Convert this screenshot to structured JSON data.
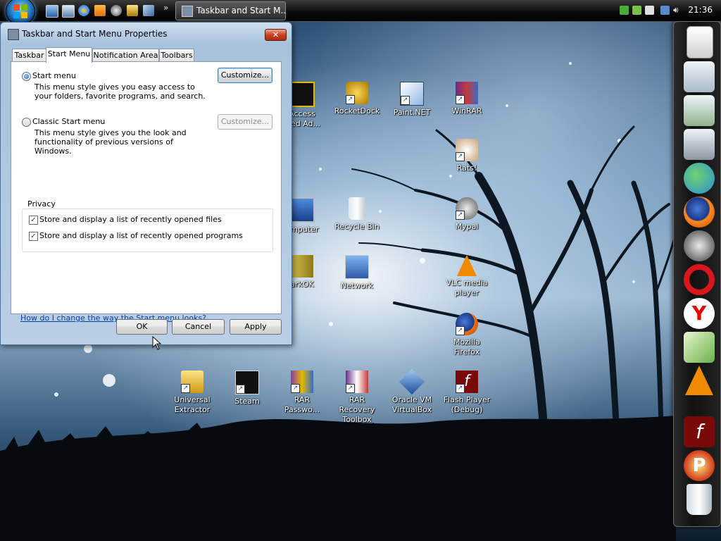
{
  "taskbar": {
    "quick_launch": [
      "show-desktop-icon",
      "switch-windows-icon",
      "internet-explorer-icon",
      "media-player-icon",
      "raccoon-app-icon",
      "virtualbox-icon"
    ],
    "more": "»",
    "active_task": "Taskbar and Start M...",
    "clock": "21:36"
  },
  "desktop_icons": [
    {
      "label": "Access\nnied Ad...",
      "icon": "access-denied-icon"
    },
    {
      "label": "RocketDock",
      "icon": "rocketdock-icon"
    },
    {
      "label": "Paint.NET",
      "icon": "paint-net-icon"
    },
    {
      "label": "WinRAR",
      "icon": "winrar-icon"
    },
    {
      "label": "Rats!",
      "icon": "rats-icon"
    },
    {
      "label": "omputer",
      "icon": "computer-icon"
    },
    {
      "label": "Recycle Bin",
      "icon": "recycle-bin-icon"
    },
    {
      "label": "Mypal",
      "icon": "mypal-icon"
    },
    {
      "label": "arkOK",
      "icon": "archive-icon"
    },
    {
      "label": "Network",
      "icon": "network-icon"
    },
    {
      "label": "VLC media\nplayer",
      "icon": "vlc-icon"
    },
    {
      "label": "Mozilla\nFirefox",
      "icon": "firefox-icon"
    },
    {
      "label": "Universal\nExtractor",
      "icon": "universal-extractor-icon"
    },
    {
      "label": "Steam",
      "icon": "steam-icon"
    },
    {
      "label": "RAR\nPasswo...",
      "icon": "rar-password-icon"
    },
    {
      "label": "RAR Recovery\nToolbox",
      "icon": "rar-recovery-icon"
    },
    {
      "label": "Oracle VM\nVirtualBox",
      "icon": "virtualbox-icon"
    },
    {
      "label": "Flash Player\n(Debug)",
      "icon": "flash-player-icon"
    }
  ],
  "dock": [
    "document-icon",
    "folder-icon",
    "folder-green-icon",
    "folder-gear-icon",
    "messenger-icon",
    "firefox-icon",
    "raccoon-icon",
    "opera-icon",
    "yandex-icon",
    "notepad-icon",
    "vlc-icon",
    "flash-icon",
    "pdf-icon",
    "trash-icon"
  ],
  "dialog": {
    "title": "Taskbar and Start Menu Properties",
    "close": "✕",
    "tabs": [
      "Taskbar",
      "Start Menu",
      "Notification Area",
      "Toolbars"
    ],
    "active_tab": "Start Menu",
    "option_start_menu": {
      "label": "Start menu",
      "description": "This menu style gives you easy access to your folders, favorite programs, and search.",
      "selected": true,
      "customize": "Customize..."
    },
    "option_classic": {
      "label": "Classic Start menu",
      "description": "This menu style gives you the look and functionality of previous versions of Windows.",
      "selected": false,
      "customize": "Customize..."
    },
    "privacy": {
      "title": "Privacy",
      "files": {
        "label": "Store and display a list of recently opened files",
        "checked": true
      },
      "programs": {
        "label": "Store and display a list of recently opened programs",
        "checked": true
      }
    },
    "help_link": "How do I change the way the Start menu looks?",
    "buttons": {
      "ok": "OK",
      "cancel": "Cancel",
      "apply": "Apply"
    }
  },
  "colors": {
    "link": "#0b3fa8",
    "title_bar": "#a7c2dd",
    "close": "#c84326"
  }
}
